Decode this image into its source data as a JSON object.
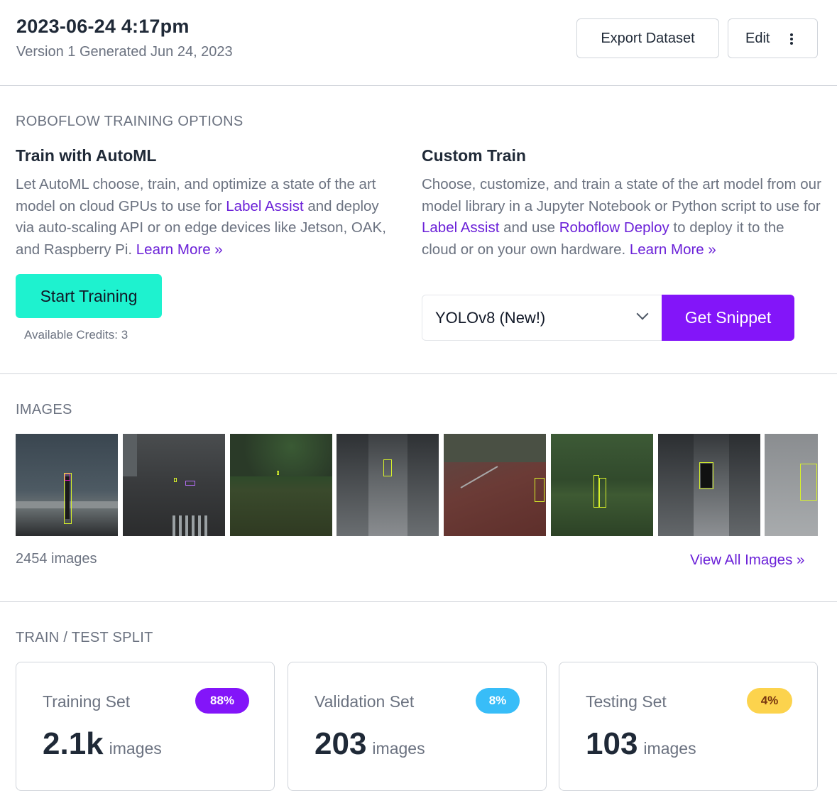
{
  "header": {
    "title": "2023-06-24 4:17pm",
    "subtitle": "Version 1 Generated Jun 24, 2023",
    "export_label": "Export Dataset",
    "edit_label": "Edit"
  },
  "training": {
    "section_label": "ROBOFLOW TRAINING OPTIONS",
    "automl": {
      "title": "Train with AutoML",
      "text_1": "Let AutoML choose, train, and optimize a state of the art model on cloud GPUs to use for ",
      "link_1": "Label Assist",
      "text_2": " and deploy via auto-scaling API or on edge devices like Jetson, OAK, and Raspberry Pi. ",
      "learn_more": "Learn More »",
      "button": "Start Training",
      "credits": "Available Credits: 3"
    },
    "custom": {
      "title": "Custom Train",
      "text_1": "Choose, customize, and train a state of the art model from our model library in a Jupyter Notebook or Python script to use for ",
      "link_1": "Label Assist",
      "text_2": " and use ",
      "link_2": "Roboflow Deploy",
      "text_3": " to deploy it to the cloud or on your own hardware. ",
      "learn_more": "Learn More »",
      "model_select": "YOLOv8 (New!)",
      "button": "Get Snippet"
    }
  },
  "images": {
    "section_label": "IMAGES",
    "count": "2454 images",
    "view_all": "View All Images »"
  },
  "split": {
    "section_label": "TRAIN / TEST SPLIT",
    "cards": [
      {
        "label": "Training Set",
        "badge": "88%",
        "value": "2.1k",
        "unit": "images",
        "badge_bg": "#8315f9",
        "badge_fg": "#ffffff"
      },
      {
        "label": "Validation Set",
        "badge": "8%",
        "value": "203",
        "unit": "images",
        "badge_bg": "#38bdf8",
        "badge_fg": "#ffffff"
      },
      {
        "label": "Testing Set",
        "badge": "4%",
        "value": "103",
        "unit": "images",
        "badge_bg": "#fcd34d",
        "badge_fg": "#78350f"
      }
    ]
  }
}
